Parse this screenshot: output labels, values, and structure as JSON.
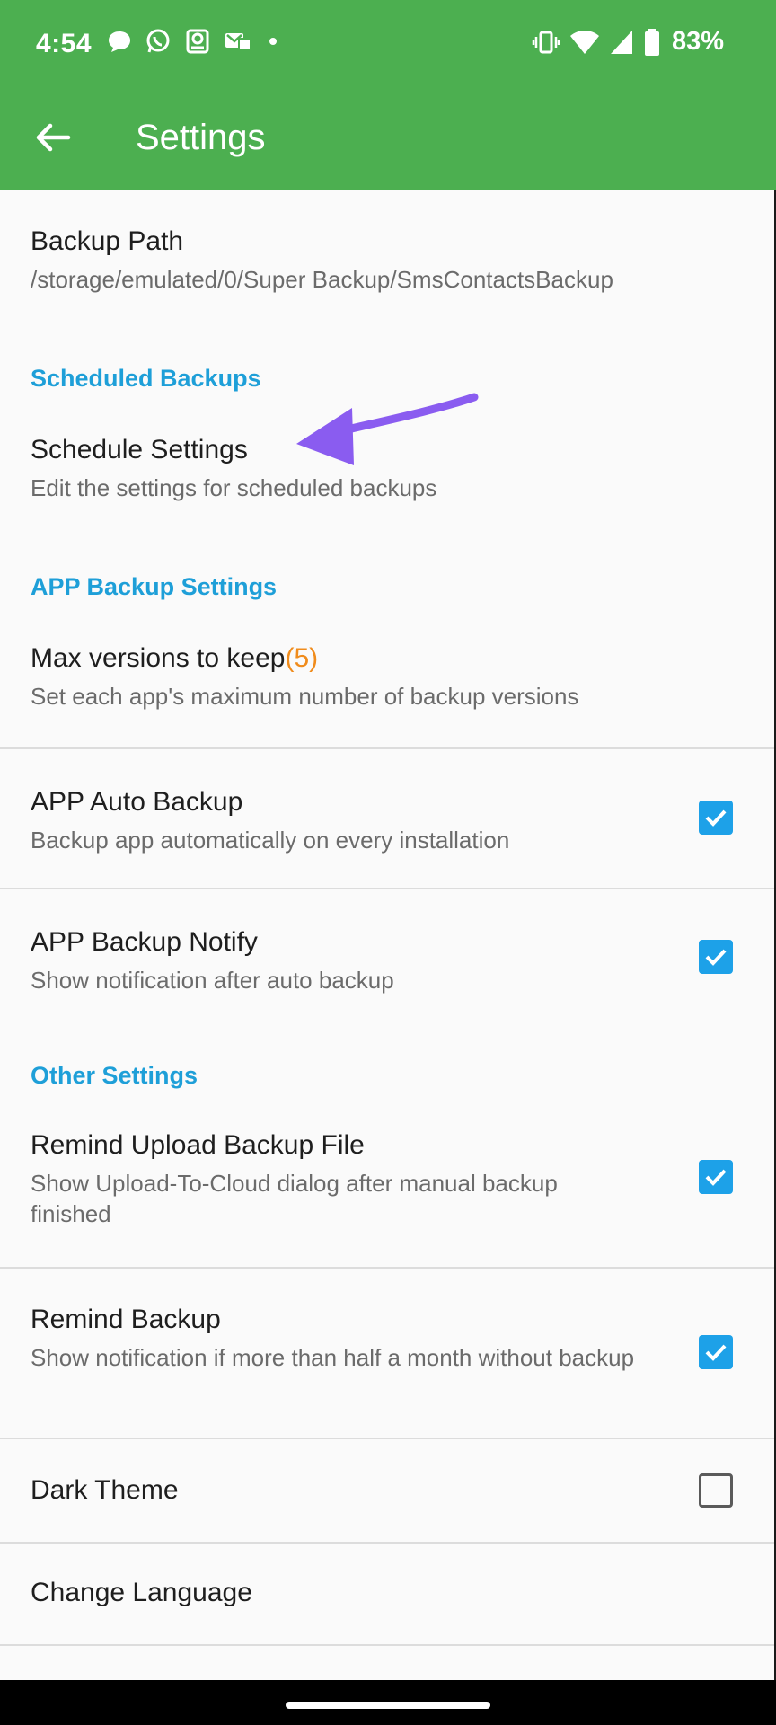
{
  "status_bar": {
    "time": "4:54",
    "battery": "83%",
    "icons_left": [
      "chat-bubble-icon",
      "whatsapp-icon",
      "disk-icon",
      "message-icon",
      "dot-icon"
    ],
    "icons_right": [
      "vibrate-icon",
      "wifi-icon",
      "signal-icon",
      "battery-icon"
    ]
  },
  "toolbar": {
    "title": "Settings"
  },
  "prefs": {
    "backup_path": {
      "title": "Backup Path",
      "summary": "/storage/emulated/0/Super Backup/SmsContactsBackup"
    },
    "category_scheduled": "Scheduled Backups",
    "schedule_settings": {
      "title": "Schedule Settings",
      "summary": "Edit the settings for scheduled backups"
    },
    "category_app_backup": "APP Backup Settings",
    "max_versions": {
      "title": "Max versions to keep",
      "value": "(5)",
      "summary": "Set each app's maximum number of backup versions"
    },
    "app_auto_backup": {
      "title": "APP Auto Backup",
      "summary": "Backup app automatically on every installation",
      "checked": true
    },
    "app_backup_notify": {
      "title": "APP Backup Notify",
      "summary": "Show notification after auto backup",
      "checked": true
    },
    "category_other": "Other Settings",
    "remind_upload": {
      "title": "Remind Upload Backup File",
      "summary": "Show Upload-To-Cloud dialog after manual backup finished",
      "checked": true
    },
    "remind_backup": {
      "title": "Remind Backup",
      "summary": "Show notification if more than half a month without backup",
      "checked": true
    },
    "dark_theme": {
      "title": "Dark Theme",
      "checked": false
    },
    "change_language": {
      "title": "Change Language"
    }
  },
  "colors": {
    "appbar": "#4caf50",
    "category": "#1e9fd8",
    "checkbox": "#1da1e8",
    "accent_value": "#f08c1c",
    "annotation_arrow": "#8a5cf0"
  }
}
